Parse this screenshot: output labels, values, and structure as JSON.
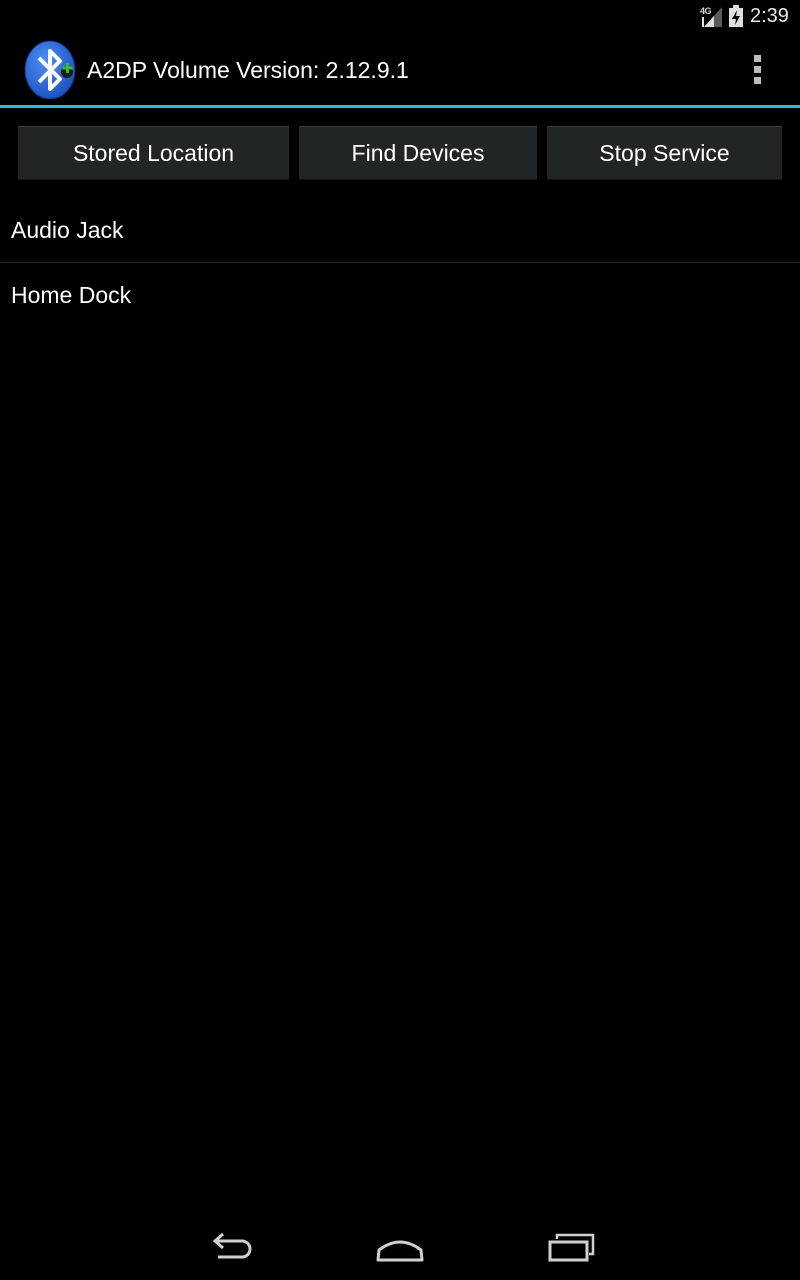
{
  "status_bar": {
    "network_type": "4G",
    "time": "2:39",
    "icons": [
      "signal-icon",
      "battery-icon"
    ]
  },
  "action_bar": {
    "title": "A2DP Volume Version: 2.12.9.1",
    "logo_icon": "bluetooth-app-icon",
    "overflow_icon": "overflow-menu-icon"
  },
  "buttons": {
    "stored_location": "Stored Location",
    "find_devices": "Find Devices",
    "stop_service": "Stop Service"
  },
  "devices": [
    {
      "label": "Audio Jack"
    },
    {
      "label": "Home Dock"
    }
  ],
  "nav_bar": {
    "icons": [
      "back-icon",
      "home-icon",
      "recents-icon"
    ]
  },
  "colors": {
    "accent": "#33b5e5",
    "background": "#000000",
    "button": "#222526",
    "logo_blue": "#1d63d9",
    "logo_green": "#2fc12a"
  }
}
